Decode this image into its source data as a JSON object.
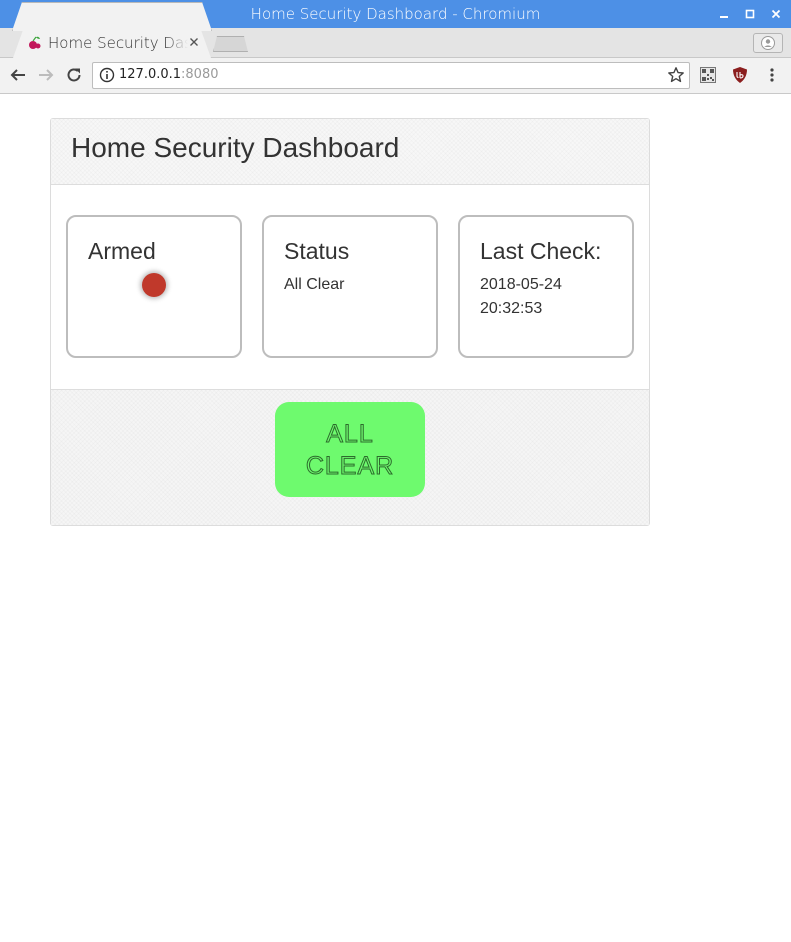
{
  "window": {
    "title": "Home Security Dashboard - Chromium",
    "controls": {
      "minimize": "–",
      "maximize": "□",
      "close": "✕"
    }
  },
  "browser": {
    "tab": {
      "title": "Home Security Dashboard",
      "close": "×"
    },
    "omnibox": {
      "host": "127.0.0.1",
      "port": ":8080"
    },
    "icons": {
      "back": "back-arrow-icon",
      "forward": "forward-arrow-icon",
      "reload": "reload-icon",
      "info": "info-icon",
      "bookmark": "star-icon",
      "extension1": "qr-code-icon",
      "extension2": "ublock-shield-icon",
      "menu": "vertical-dots-icon",
      "profile": "profile-icon"
    }
  },
  "dashboard": {
    "title": "Home Security Dashboard",
    "cards": [
      {
        "title": "Armed",
        "indicator_color": "#c0392b"
      },
      {
        "title": "Status",
        "text": "All Clear"
      },
      {
        "title": "Last Check:",
        "text": "2018-05-24 20:32:53"
      }
    ],
    "action_button": {
      "label": "ALL CLEAR",
      "color": "#6efa6e"
    }
  }
}
